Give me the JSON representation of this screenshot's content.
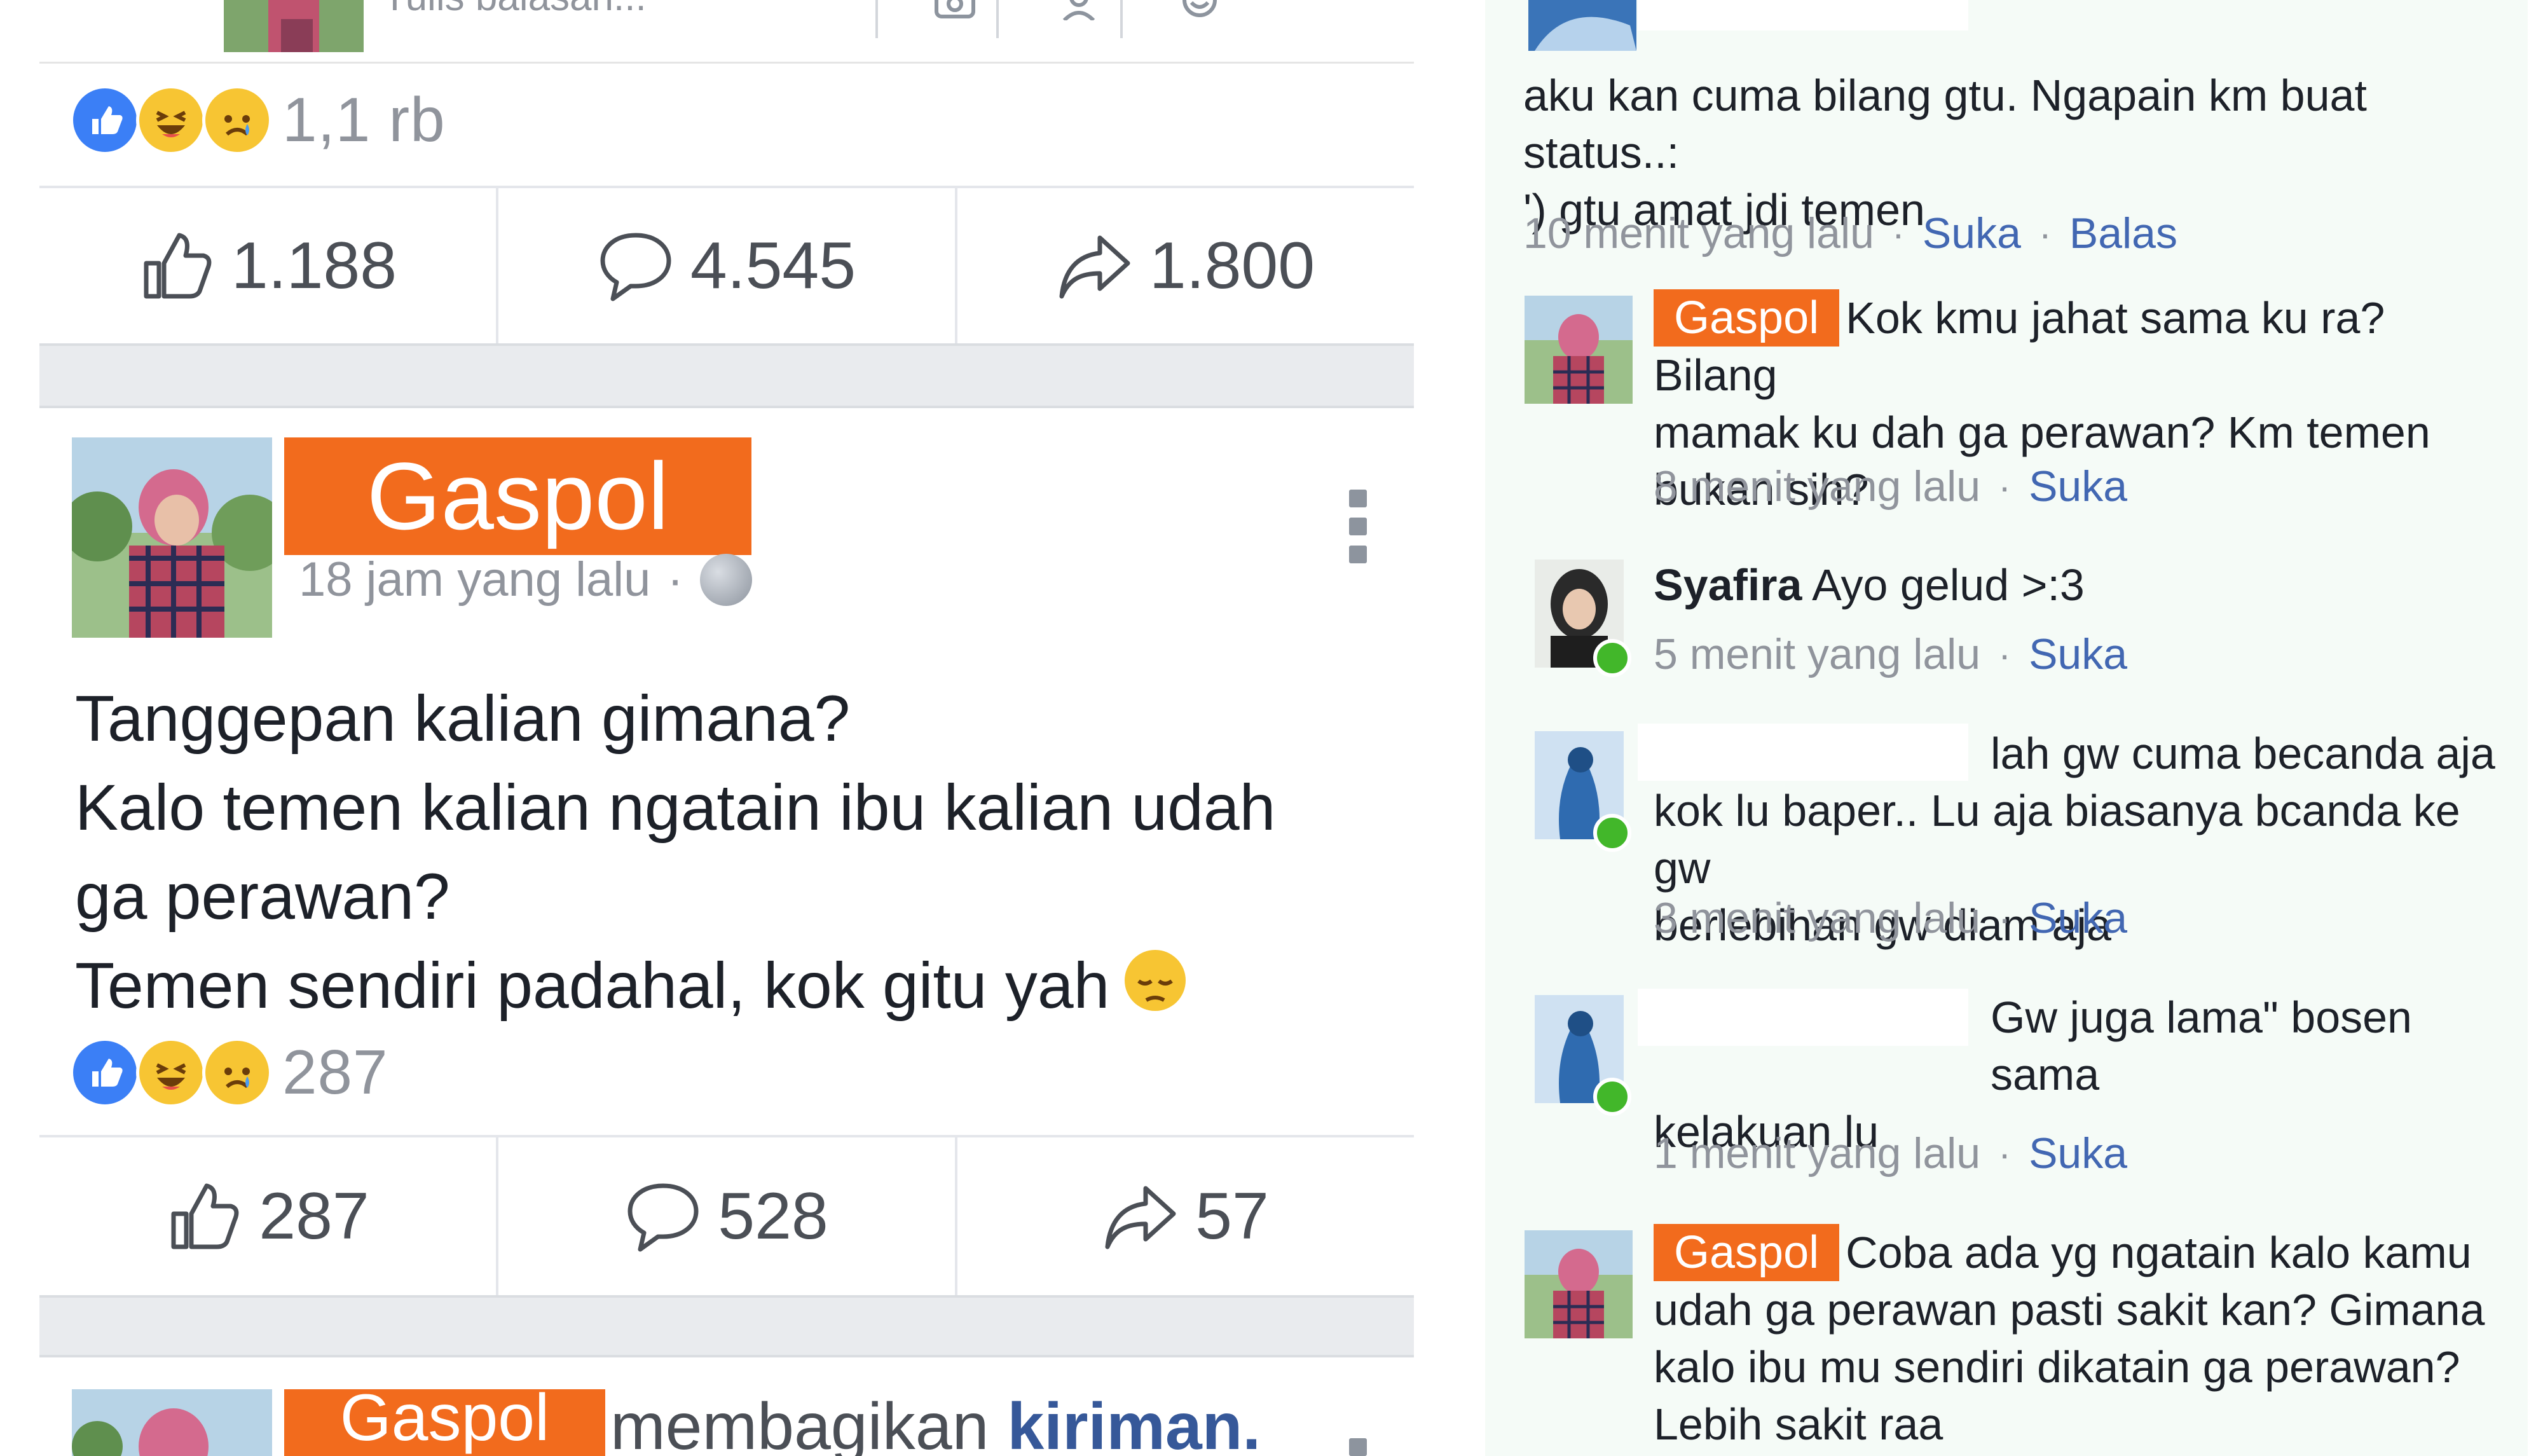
{
  "top_post": {
    "reply_placeholder": "Tulis balasan...",
    "reactions_count": "1,1 rb",
    "likes": "1.188",
    "comments": "4.545",
    "shares": "1.800"
  },
  "main_post": {
    "author": "Gaspol",
    "time": "18 jam yang lalu",
    "privacy_icon": "globe-icon",
    "text_lines": [
      "Tanggepan kalian gimana?",
      "Kalo temen kalian ngatain ibu kalian udah",
      "ga perawan?",
      "Temen sendiri padahal, kok gitu yah"
    ],
    "reactions_count": "287",
    "likes": "287",
    "comments": "528",
    "shares": "57"
  },
  "next_post": {
    "author": "Gaspol",
    "action_text": "membagikan",
    "link_text": "kiriman."
  },
  "comments": [
    {
      "id": "c1",
      "text": "aku kan cuma bilang gtu. Ngapain km buat status..: ') gtu amat jdi temen",
      "line1": "aku kan cuma bilang gtu. Ngapain km buat status..:",
      "line2": "') gtu amat jdi temen",
      "time": "10 menit yang lalu",
      "like": "Suka",
      "reply": "Balas"
    },
    {
      "id": "c2",
      "author": "Gaspol",
      "line1": "Kok kmu jahat sama ku ra? Bilang",
      "line2": "mamak ku dah ga perawan?  Km temen",
      "line3": "bukan sih?",
      "time": "8 menit yang lalu",
      "like": "Suka"
    },
    {
      "id": "c3",
      "author": "Syafira",
      "text": "Ayo gelud >:3",
      "time": "5 menit yang lalu",
      "like": "Suka"
    },
    {
      "id": "c4",
      "line1": "lah gw cuma becanda aja",
      "line2": "kok lu baper.. Lu aja biasanya bcanda ke gw",
      "line3": "berlebihan gw diam aja",
      "time": "3 menit yang lalu",
      "like": "Suka"
    },
    {
      "id": "c5",
      "line1": "Gw juga lama\" bosen sama",
      "line2": "kelakuan lu",
      "time": "1 menit yang lalu",
      "like": "Suka"
    },
    {
      "id": "c6",
      "author": "Gaspol",
      "line1": "Coba ada yg ngatain kalo kamu",
      "line2": "udah ga perawan pasti sakit kan?  Gimana",
      "line3": "kalo ibu mu sendiri dikatain ga perawan?",
      "line4": "Lebih sakit raa"
    }
  ],
  "colors": {
    "name_tag": "#f26b1d",
    "link": "#4267b2",
    "meta_gray": "#90949c",
    "online": "#42b72a",
    "like_blue": "#3b7ff6"
  }
}
